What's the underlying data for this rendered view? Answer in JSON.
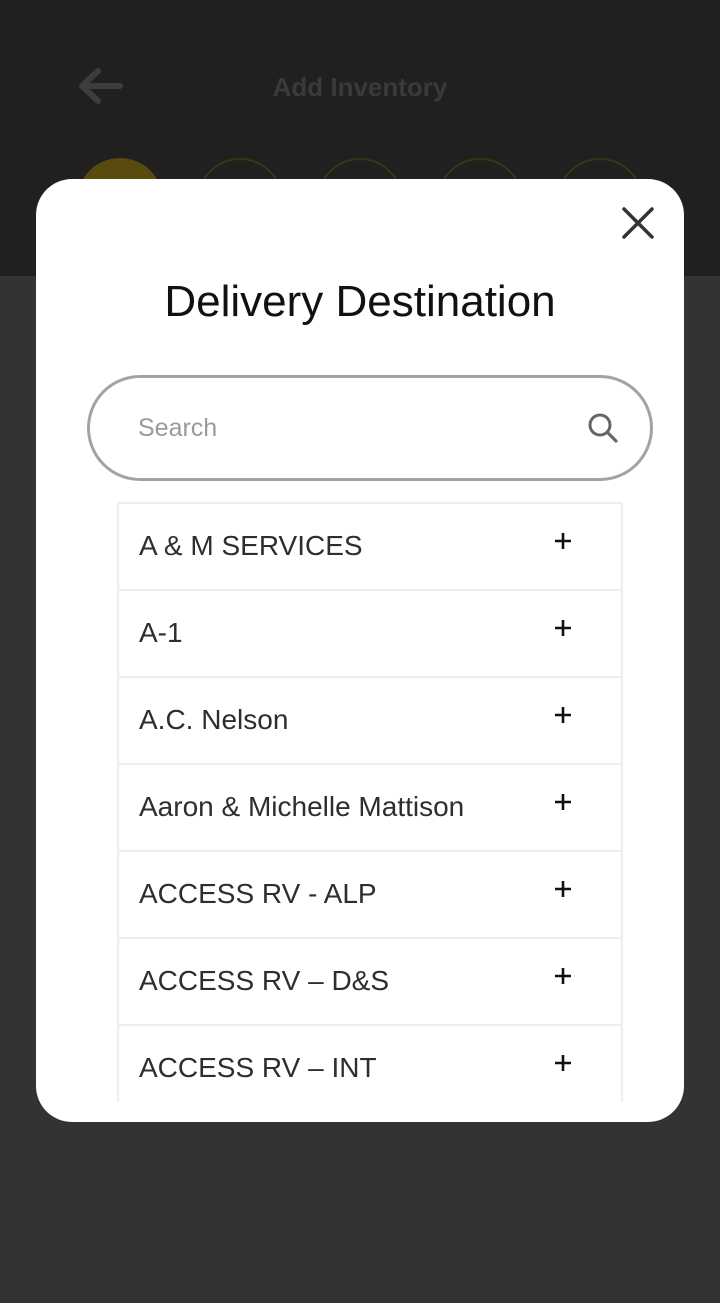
{
  "app": {
    "title": "Add Inventory",
    "back_icon": "arrow-left-icon",
    "steps": [
      {
        "state": "active"
      },
      {
        "state": "inactive"
      },
      {
        "state": "inactive"
      },
      {
        "state": "inactive"
      },
      {
        "state": "inactive"
      }
    ],
    "colors": {
      "header_bg": "#202020",
      "page_bg": "#333333",
      "accent": "#f2c413"
    }
  },
  "modal": {
    "title": "Delivery Destination",
    "close_icon": "close-icon",
    "search": {
      "placeholder": "Search",
      "value": "",
      "icon": "search-icon"
    },
    "items": [
      {
        "label": "A & M SERVICES",
        "icon": "plus-icon"
      },
      {
        "label": "A-1",
        "icon": "plus-icon"
      },
      {
        "label": "A.C. Nelson",
        "icon": "plus-icon"
      },
      {
        "label": "Aaron & Michelle Mattison",
        "icon": "plus-icon"
      },
      {
        "label": "ACCESS RV - ALP",
        "icon": "plus-icon"
      },
      {
        "label": "ACCESS RV – D&S",
        "icon": "plus-icon"
      },
      {
        "label": "ACCESS RV – INT",
        "icon": "plus-icon"
      }
    ]
  }
}
